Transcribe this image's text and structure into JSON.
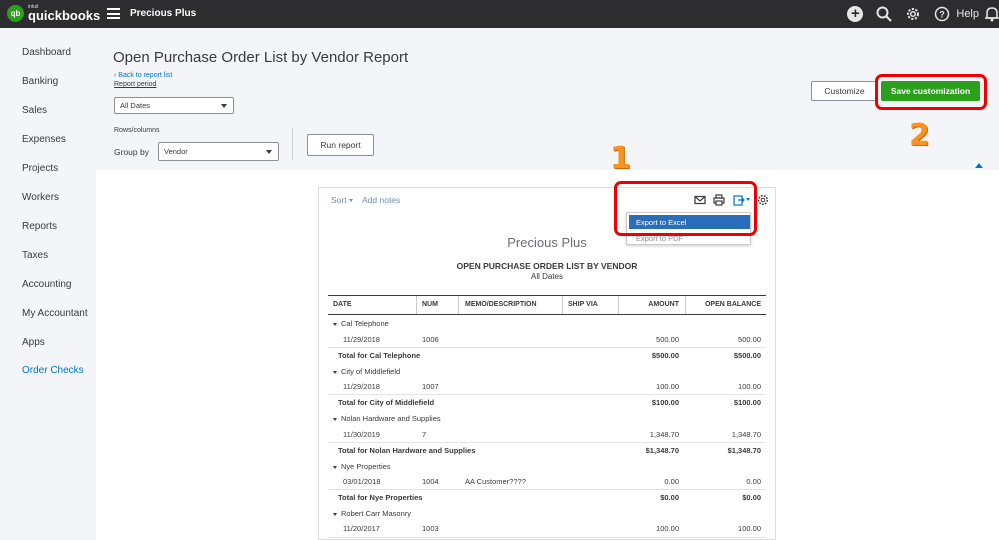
{
  "topbar": {
    "logo_small": "intuit",
    "logo_name": "quickbooks",
    "logo_badge": "qb",
    "company": "Precious Plus",
    "help_label": "Help"
  },
  "sidebar": {
    "items": [
      {
        "label": "Dashboard"
      },
      {
        "label": "Banking"
      },
      {
        "label": "Sales"
      },
      {
        "label": "Expenses"
      },
      {
        "label": "Projects"
      },
      {
        "label": "Workers"
      },
      {
        "label": "Reports"
      },
      {
        "label": "Taxes"
      },
      {
        "label": "Accounting"
      },
      {
        "label": "My Accountant"
      },
      {
        "label": "Apps"
      },
      {
        "label": "Order Checks"
      }
    ]
  },
  "header": {
    "title": "Open Purchase Order List by Vendor Report",
    "back_link": "Back to report list",
    "report_period_label": "Report period",
    "report_period_value": "All Dates",
    "rows_columns_label": "Rows/columns",
    "group_by_label": "Group by",
    "group_by_value": "Vendor",
    "run_report": "Run report",
    "customize": "Customize",
    "save_customization": "Save customization"
  },
  "annotations": {
    "one": "1",
    "two": "2"
  },
  "toolbar": {
    "sort": "Sort",
    "add_notes": "Add notes",
    "export_menu": [
      "Export to Excel",
      "Export to PDF"
    ]
  },
  "report": {
    "company": "Precious Plus",
    "title": "OPEN PURCHASE ORDER LIST BY VENDOR",
    "dates": "All Dates",
    "columns": [
      "DATE",
      "NUM",
      "MEMO/DESCRIPTION",
      "SHIP VIA",
      "AMOUNT",
      "OPEN BALANCE"
    ],
    "groups": [
      {
        "vendor": "Cal Telephone",
        "date": "11/29/2018",
        "num": "1006",
        "memo": "",
        "amount": "500.00",
        "open_balance": "500.00",
        "total_label": "Total for Cal Telephone",
        "total_amount": "$500.00",
        "total_balance": "$500.00"
      },
      {
        "vendor": "City of Middlefield",
        "date": "11/29/2018",
        "num": "1007",
        "memo": "",
        "amount": "100.00",
        "open_balance": "100.00",
        "total_label": "Total for City of Middlefield",
        "total_amount": "$100.00",
        "total_balance": "$100.00"
      },
      {
        "vendor": "Nolan Hardware and Supplies",
        "date": "11/30/2019",
        "num": "7",
        "memo": "",
        "amount": "1,348.70",
        "open_balance": "1,348.70",
        "total_label": "Total for Nolan Hardware and Supplies",
        "total_amount": "$1,348.70",
        "total_balance": "$1,348.70"
      },
      {
        "vendor": "Nye Properties",
        "date": "03/01/2018",
        "num": "1004",
        "memo": "AA Customer????",
        "amount": "0.00",
        "open_balance": "0.00",
        "total_label": "Total for Nye Properties",
        "total_amount": "$0.00",
        "total_balance": "$0.00"
      },
      {
        "vendor": "Robert Carr Masonry",
        "date": "11/20/2017",
        "num": "1003",
        "memo": "",
        "amount": "100.00",
        "open_balance": "100.00"
      }
    ]
  }
}
